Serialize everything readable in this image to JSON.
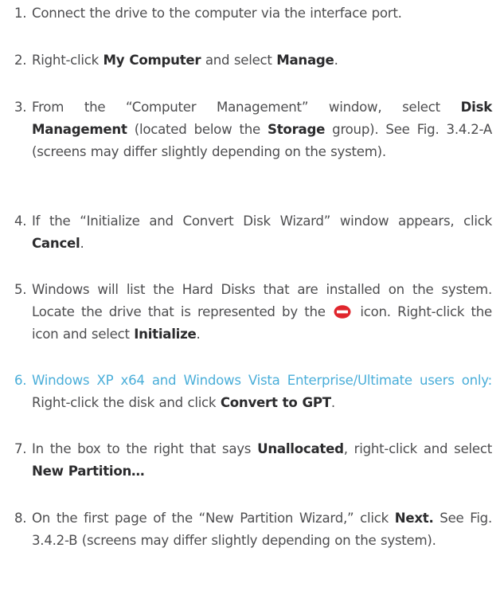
{
  "steps": [
    {
      "num": "1.",
      "text": "Connect the drive to the computer via the interface port."
    },
    {
      "num": "2.",
      "pre": "Right-click ",
      "b1": "My Computer",
      "mid": " and select ",
      "b2": "Manage",
      "post": "."
    },
    {
      "num": "3.",
      "pre": "From the “Computer Management” window, select ",
      "b1": "Disk Management",
      "mid": " (located below the ",
      "b2": "Storage",
      "post": " group). See Fig. 3.4.2-A (screens may differ slightly depending on the system)."
    },
    {
      "num": "4.",
      "pre": "If the “Initialize and Convert Disk Wizard” window appears, click ",
      "b1": "Cancel",
      "post": "."
    },
    {
      "num": "5.",
      "pre": "Windows will list the Hard Disks that are installed on the system. Locate the drive that is represented by the ",
      "post_icon": " icon. Right-click the icon and select ",
      "b1": "Initialize",
      "post": "."
    },
    {
      "num": "6.",
      "note": "Windows XP x64 and Windows Vista Enterprise/Ultimate users only:",
      "pre": " Right-click the disk and click ",
      "b1": "Convert to GPT",
      "post": "."
    },
    {
      "num": "7.",
      "pre": "In the box to the right that says ",
      "b1": "Unallocated",
      "mid": ", right-click and select ",
      "b2": "New Partition…"
    },
    {
      "num": "8.",
      "pre": "On the first page of the “New Partition Wizard,” click ",
      "b1": "Next.",
      "post": " See Fig. 3.4.2-B (screens may differ slightly depending on the system)."
    }
  ],
  "colors": {
    "text": "#4d4d4f",
    "note": "#4aaed9",
    "stop_icon": "#e0262d"
  },
  "icons": {
    "step5": "disk-not-initialized-icon"
  }
}
